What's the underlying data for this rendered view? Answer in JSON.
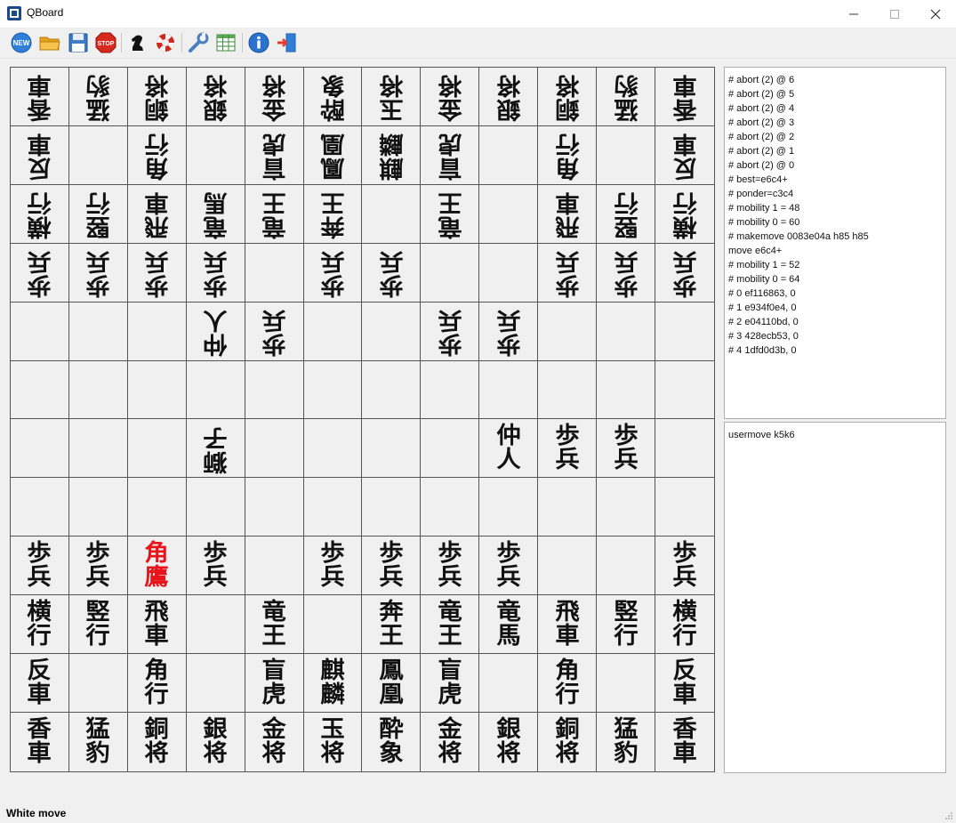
{
  "window": {
    "title": "QBoard"
  },
  "toolbar": {
    "buttons": [
      {
        "id": "new",
        "icon": "new-icon",
        "label": "NEW"
      },
      {
        "id": "open",
        "icon": "folder-open-icon"
      },
      {
        "id": "save",
        "icon": "floppy-disk-icon"
      },
      {
        "id": "stop",
        "icon": "stop-sign-icon",
        "label": "STOP"
      },
      {
        "id": "engine",
        "icon": "knight-icon"
      },
      {
        "id": "help",
        "icon": "lifebuoy-icon"
      },
      {
        "id": "settings",
        "icon": "wrench-icon"
      },
      {
        "id": "board",
        "icon": "grid-table-icon"
      },
      {
        "id": "about",
        "icon": "info-icon"
      },
      {
        "id": "exit",
        "icon": "exit-door-icon"
      }
    ]
  },
  "colors": {
    "normal_piece": "#111111",
    "highlight_piece": "#e8141b",
    "board_bg": "#f0f0f0",
    "grid": "#555555"
  },
  "board": {
    "rows": [
      [
        {
          "t": "香車",
          "g": 1
        },
        {
          "t": "猛豹",
          "g": 1
        },
        {
          "t": "銅将",
          "g": 1
        },
        {
          "t": "銀将",
          "g": 1
        },
        {
          "t": "金将",
          "g": 1
        },
        {
          "t": "酔象",
          "g": 1
        },
        {
          "t": "玉将",
          "g": 1
        },
        {
          "t": "金将",
          "g": 1
        },
        {
          "t": "銀将",
          "g": 1
        },
        {
          "t": "銅将",
          "g": 1
        },
        {
          "t": "猛豹",
          "g": 1
        },
        {
          "t": "香車",
          "g": 1
        }
      ],
      [
        {
          "t": "反車",
          "g": 1
        },
        null,
        {
          "t": "角行",
          "g": 1
        },
        null,
        {
          "t": "盲虎",
          "g": 1
        },
        {
          "t": "鳳凰",
          "g": 1
        },
        {
          "t": "麒麟",
          "g": 1
        },
        {
          "t": "盲虎",
          "g": 1
        },
        null,
        {
          "t": "角行",
          "g": 1
        },
        null,
        {
          "t": "反車",
          "g": 1
        }
      ],
      [
        {
          "t": "横行",
          "g": 1
        },
        {
          "t": "竪行",
          "g": 1
        },
        {
          "t": "飛車",
          "g": 1
        },
        {
          "t": "竜馬",
          "g": 1
        },
        {
          "t": "竜王",
          "g": 1
        },
        {
          "t": "奔王",
          "g": 1
        },
        null,
        {
          "t": "竜王",
          "g": 1
        },
        null,
        {
          "t": "飛車",
          "g": 1
        },
        {
          "t": "竪行",
          "g": 1
        },
        {
          "t": "横行",
          "g": 1
        }
      ],
      [
        {
          "t": "歩兵",
          "g": 1
        },
        {
          "t": "歩兵",
          "g": 1
        },
        {
          "t": "歩兵",
          "g": 1
        },
        {
          "t": "歩兵",
          "g": 1
        },
        null,
        {
          "t": "歩兵",
          "g": 1
        },
        {
          "t": "歩兵",
          "g": 1
        },
        null,
        null,
        {
          "t": "歩兵",
          "g": 1
        },
        {
          "t": "歩兵",
          "g": 1
        },
        {
          "t": "歩兵",
          "g": 1
        }
      ],
      [
        null,
        null,
        null,
        {
          "t": "仲人",
          "g": 1
        },
        {
          "t": "歩兵",
          "g": 1
        },
        null,
        null,
        {
          "t": "歩兵",
          "g": 1
        },
        {
          "t": "歩兵",
          "g": 1
        },
        null,
        null,
        null
      ],
      [
        null,
        null,
        null,
        null,
        null,
        null,
        null,
        null,
        null,
        null,
        null,
        null
      ],
      [
        null,
        null,
        null,
        {
          "t": "獅子",
          "g": 1
        },
        null,
        null,
        null,
        null,
        {
          "t": "仲人",
          "g": 0
        },
        {
          "t": "歩兵",
          "g": 0
        },
        {
          "t": "歩兵",
          "g": 0
        },
        null
      ],
      [
        null,
        null,
        null,
        null,
        null,
        null,
        null,
        null,
        null,
        null,
        null,
        null
      ],
      [
        {
          "t": "歩兵",
          "g": 0
        },
        {
          "t": "歩兵",
          "g": 0
        },
        {
          "t": "角鷹",
          "g": 0,
          "red": 1
        },
        {
          "t": "歩兵",
          "g": 0
        },
        null,
        {
          "t": "歩兵",
          "g": 0
        },
        {
          "t": "歩兵",
          "g": 0
        },
        {
          "t": "歩兵",
          "g": 0
        },
        {
          "t": "歩兵",
          "g": 0
        },
        null,
        null,
        {
          "t": "歩兵",
          "g": 0
        }
      ],
      [
        {
          "t": "横行",
          "g": 0
        },
        {
          "t": "竪行",
          "g": 0
        },
        {
          "t": "飛車",
          "g": 0
        },
        null,
        {
          "t": "竜王",
          "g": 0
        },
        null,
        {
          "t": "奔王",
          "g": 0
        },
        {
          "t": "竜王",
          "g": 0
        },
        {
          "t": "竜馬",
          "g": 0
        },
        {
          "t": "飛車",
          "g": 0
        },
        {
          "t": "竪行",
          "g": 0
        },
        {
          "t": "横行",
          "g": 0
        }
      ],
      [
        {
          "t": "反車",
          "g": 0
        },
        null,
        {
          "t": "角行",
          "g": 0
        },
        null,
        {
          "t": "盲虎",
          "g": 0
        },
        {
          "t": "麒麟",
          "g": 0
        },
        {
          "t": "鳳凰",
          "g": 0
        },
        {
          "t": "盲虎",
          "g": 0
        },
        null,
        {
          "t": "角行",
          "g": 0
        },
        null,
        {
          "t": "反車",
          "g": 0
        }
      ],
      [
        {
          "t": "香車",
          "g": 0
        },
        {
          "t": "猛豹",
          "g": 0
        },
        {
          "t": "銅将",
          "g": 0
        },
        {
          "t": "銀将",
          "g": 0
        },
        {
          "t": "金将",
          "g": 0
        },
        {
          "t": "玉将",
          "g": 0
        },
        {
          "t": "酔象",
          "g": 0
        },
        {
          "t": "金将",
          "g": 0
        },
        {
          "t": "銀将",
          "g": 0
        },
        {
          "t": "銅将",
          "g": 0
        },
        {
          "t": "猛豹",
          "g": 0
        },
        {
          "t": "香車",
          "g": 0
        }
      ]
    ]
  },
  "engine_log": {
    "lines": [
      "# abort (2) @ 6",
      "# abort (2) @ 5",
      "# abort (2) @ 4",
      "# abort (2) @ 3",
      "# abort (2) @ 2",
      "# abort (2) @ 1",
      "# abort (2) @ 0",
      "# best=e6c4+",
      "# ponder=c3c4",
      "# mobility 1 = 48",
      "# mobility 0 = 60",
      "# makemove 0083e04a h85 h85",
      "move e6c4+",
      "# mobility 1 = 52",
      "# mobility 0 = 64",
      "# 0 ef116863, 0",
      "# 1 e934f0e4, 0",
      "# 2 e04110bd, 0",
      "# 3 428ecb53, 0",
      "# 4 1dfd0d3b, 0"
    ]
  },
  "command_log": {
    "lines": [
      "usermove k5k6"
    ]
  },
  "status": {
    "text": "White move"
  }
}
